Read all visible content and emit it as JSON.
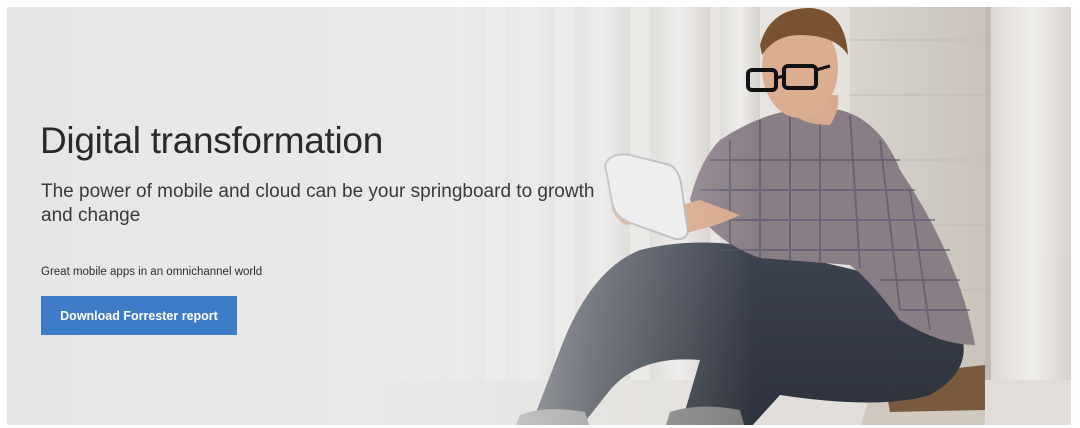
{
  "hero": {
    "title": "Digital transformation",
    "subtitle": "The power of mobile and cloud can be your springboard to growth and change",
    "tagline": "Great mobile apps in an omnichannel world",
    "cta_label": "Download Forrester report"
  },
  "colors": {
    "cta_background": "#3e7cc8",
    "cta_text": "#ffffff",
    "headline_text": "#2a2a2a"
  }
}
